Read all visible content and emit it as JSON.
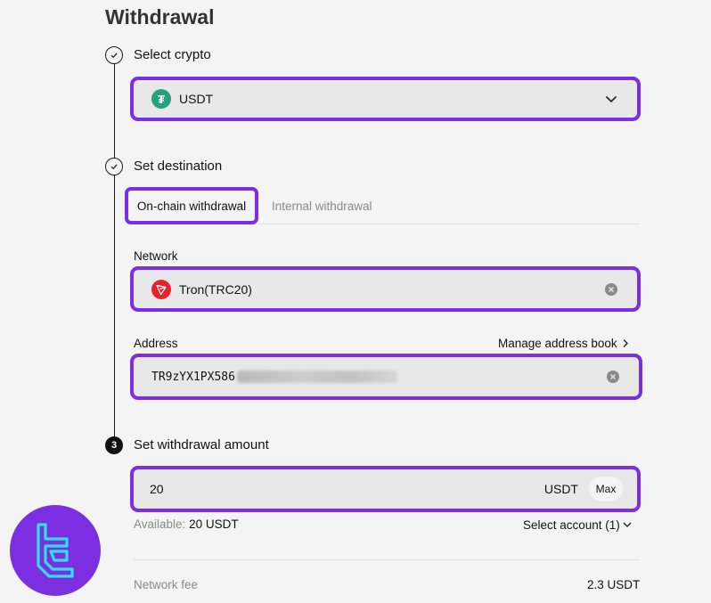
{
  "page": {
    "title": "Withdrawal"
  },
  "steps": {
    "select_crypto": {
      "label": "Select crypto",
      "selected_coin": "USDT"
    },
    "set_destination": {
      "label": "Set destination",
      "tabs": [
        "On-chain withdrawal",
        "Internal withdrawal"
      ],
      "network_label": "Network",
      "network_value": "Tron(TRC20)",
      "address_label": "Address",
      "manage_link": "Manage address book",
      "address_value": "TR9zYX1PX586"
    },
    "set_amount": {
      "number": "3",
      "label": "Set withdrawal amount",
      "amount": "20",
      "unit": "USDT",
      "max_label": "Max",
      "available_label": "Available:",
      "available_value": "20 USDT",
      "select_account": "Select account (1)"
    }
  },
  "fee": {
    "label": "Network fee",
    "value": "2.3 USDT"
  },
  "colors": {
    "accent": "#7a2ee6",
    "usdt": "#26a17b",
    "tron": "#e8222b",
    "logo_bg": "#7b2fe0",
    "logo_fg": "#2de2f0"
  },
  "icons": [
    "check-icon",
    "chevron-down-icon",
    "usdt-icon",
    "tron-icon",
    "clear-icon",
    "chevron-right-icon",
    "logo-icon"
  ]
}
